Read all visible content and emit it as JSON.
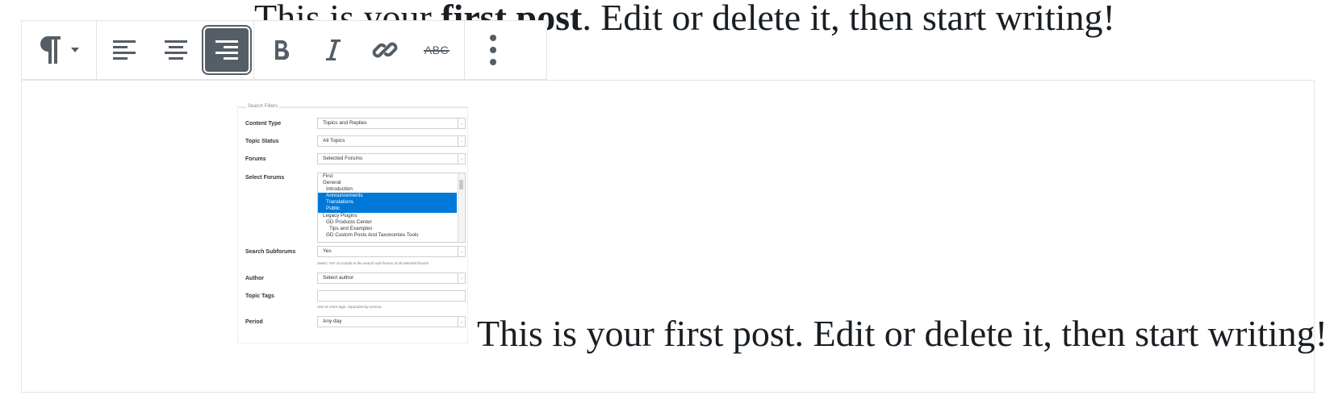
{
  "paragraph": {
    "before": "This is your ",
    "bold": "first post",
    "after": ". Edit or delete it, then start writing!"
  },
  "toolbar": {
    "paragraph_icon": "pilcrow-icon",
    "buttons": [
      {
        "name": "align-left-icon",
        "active": false
      },
      {
        "name": "align-center-icon",
        "active": false
      },
      {
        "name": "align-right-icon",
        "active": true
      },
      {
        "name": "bold-icon",
        "active": false
      },
      {
        "name": "italic-icon",
        "active": false
      },
      {
        "name": "link-icon",
        "active": false
      },
      {
        "name": "strikethrough-icon",
        "active": false
      },
      {
        "name": "more-options-icon",
        "active": false
      }
    ],
    "strike_label": "ABC"
  },
  "screenshot": {
    "legend": "Search Filters",
    "content_type": {
      "label": "Content Type",
      "value": "Topics and Replies"
    },
    "topic_status": {
      "label": "Topic Status",
      "value": "All Topics"
    },
    "forums": {
      "label": "Forums",
      "value": "Selected Forums"
    },
    "select_forums": {
      "label": "Select Forums",
      "options": [
        {
          "text": "First",
          "selected": false,
          "indent": 0
        },
        {
          "text": "General",
          "selected": false,
          "indent": 0
        },
        {
          "text": "Introduction",
          "selected": false,
          "indent": 1
        },
        {
          "text": "Announcements",
          "selected": true,
          "indent": 1
        },
        {
          "text": "Translations",
          "selected": true,
          "indent": 1
        },
        {
          "text": "Public",
          "selected": true,
          "indent": 1
        },
        {
          "text": "Legacy Plugins",
          "selected": false,
          "indent": 0
        },
        {
          "text": "GD Products Center",
          "selected": false,
          "indent": 1
        },
        {
          "text": "Tips and Examples",
          "selected": false,
          "indent": 2
        },
        {
          "text": "GD Custom Posts And Taxonomies Tools",
          "selected": false,
          "indent": 1
        }
      ]
    },
    "search_subforums": {
      "label": "Search Subforums",
      "value": "Yes",
      "hint": "Select 'Yes' to include in the search sub-forums of all selected forums."
    },
    "author": {
      "label": "Author",
      "value": "Select author"
    },
    "topic_tags": {
      "label": "Topic Tags",
      "value": "",
      "hint": "One or more tags, separated by comma."
    },
    "period": {
      "label": "Period",
      "value": "Any day"
    }
  },
  "caption": "This is your first post. Edit or delete it, then start writing!"
}
